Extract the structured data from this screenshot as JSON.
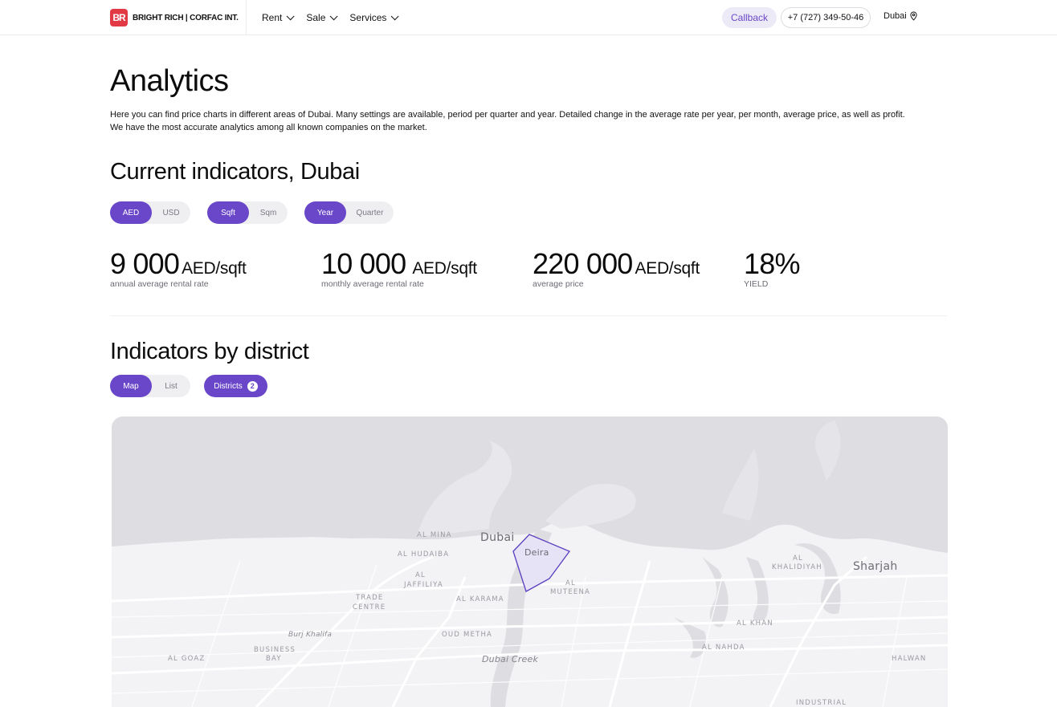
{
  "header": {
    "logo_mark": "BR",
    "logo_text": "BRIGHT RICH | CORFAC INT.",
    "nav": [
      {
        "label": "Rent"
      },
      {
        "label": "Sale"
      },
      {
        "label": "Services"
      }
    ],
    "callback_label": "Callback",
    "phone": "+7 (727) 349-50-46",
    "city": "Dubai"
  },
  "page": {
    "title": "Analytics",
    "intro_line1": "Here you can find price charts in different areas of Dubai. Many settings are available, period per quarter and year. Detailed change in the average rate per year, per month, average price, as well as profit.",
    "intro_line2": "We have the most accurate analytics among all known companies on the market."
  },
  "current": {
    "heading": "Current indicators, Dubai",
    "currency_toggle": {
      "options": [
        "AED",
        "USD"
      ],
      "selected": "AED"
    },
    "area_toggle": {
      "options": [
        "Sqft",
        "Sqm"
      ],
      "selected": "Sqft"
    },
    "period_toggle": {
      "options": [
        "Year",
        "Quarter"
      ],
      "selected": "Year"
    },
    "metrics": [
      {
        "value": "9 000",
        "unit": "AED/sqft",
        "label": "annual average rental rate"
      },
      {
        "value": "10 000",
        "unit": "AED/sqft",
        "label": "monthly average rental rate"
      },
      {
        "value": "220 000",
        "unit": "AED/sqft",
        "label": "average price"
      },
      {
        "value": "18%",
        "unit": "",
        "label": "YIELD"
      }
    ]
  },
  "districts": {
    "heading": "Indicators by district",
    "view_toggle": {
      "options": [
        "Map",
        "List"
      ],
      "selected": "Map"
    },
    "districts_button": {
      "label": "Districts",
      "count": "2"
    }
  },
  "map": {
    "labels": {
      "dubai": "Dubai",
      "deira": "Deira",
      "sharjah": "Sharjah",
      "al_mina": "AL MINA",
      "al_hudaiba": "AL HUDAIBA",
      "al_jaffiliya_1": "AL",
      "al_jaffiliya_2": "JAFFILIYA",
      "trade_centre_1": "TRADE",
      "trade_centre_2": "CENTRE",
      "al_karama": "AL KARAMA",
      "al_muteena_1": "AL",
      "al_muteena_2": "MUTEENA",
      "al_khalidiyah_1": "AL",
      "al_khalidiyah_2": "KHALIDIYAH",
      "burj_khalifa": "Burj Khalifa",
      "business_bay_1": "BUSINESS",
      "business_bay_2": "BAY",
      "oud_metha": "OUD METHA",
      "dubai_creek": "Dubai Creek",
      "al_goaz": "AL GOAZ",
      "al_khan": "AL KHAN",
      "al_nahda": "AL NAHDA",
      "halwan": "HALWAN",
      "industrial": "INDUSTRIAL"
    },
    "colors": {
      "water": "#dedee2",
      "land": "#f3f3f5",
      "road": "#ffffff",
      "highlight_fill": "#e7e3f7",
      "highlight_stroke": "#5a3ec0"
    }
  },
  "accent_color": "#6a47c9"
}
